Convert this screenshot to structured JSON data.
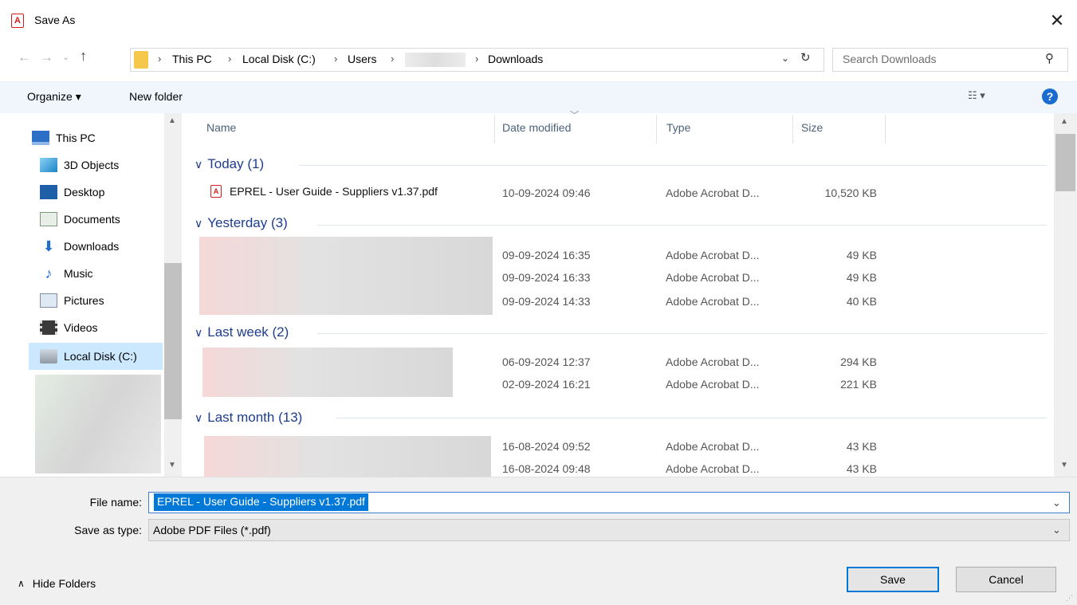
{
  "window": {
    "title": "Save As",
    "close_glyph": "✕",
    "accent_pdf": "#d21e1e"
  },
  "address": {
    "crumbs": [
      "This PC",
      "Local Disk (C:)",
      "Users",
      "Downloads"
    ],
    "separator": "›",
    "search_placeholder": "Search Downloads"
  },
  "toolbar": {
    "organize": "Organize ▾",
    "new_folder": "New folder",
    "view_icon": "view-options-icon",
    "help": "?"
  },
  "nav": {
    "items": [
      {
        "label": "This PC",
        "icon": "computer-icon"
      },
      {
        "label": "3D Objects",
        "icon": "cube-icon"
      },
      {
        "label": "Desktop",
        "icon": "desktop-icon"
      },
      {
        "label": "Documents",
        "icon": "documents-icon"
      },
      {
        "label": "Downloads",
        "icon": "download-arrow-icon"
      },
      {
        "label": "Music",
        "icon": "music-note-icon"
      },
      {
        "label": "Pictures",
        "icon": "pictures-icon"
      },
      {
        "label": "Videos",
        "icon": "film-icon"
      },
      {
        "label": "Local Disk (C:)",
        "icon": "drive-icon",
        "selected": true
      }
    ]
  },
  "columns": {
    "name": "Name",
    "date": "Date modified",
    "type": "Type",
    "size": "Size"
  },
  "groups": [
    {
      "label": "Today (1)",
      "rows": [
        {
          "name": "EPREL - User Guide - Suppliers v1.37.pdf",
          "date": "10-09-2024 09:46",
          "type": "Adobe Acrobat D...",
          "size": "10,520 KB"
        }
      ]
    },
    {
      "label": "Yesterday (3)",
      "rows": [
        {
          "name": "",
          "date": "09-09-2024 16:35",
          "type": "Adobe Acrobat D...",
          "size": "49 KB"
        },
        {
          "name": "",
          "date": "09-09-2024 16:33",
          "type": "Adobe Acrobat D...",
          "size": "49 KB"
        },
        {
          "name": "",
          "date": "09-09-2024 14:33",
          "type": "Adobe Acrobat D...",
          "size": "40 KB"
        }
      ]
    },
    {
      "label": "Last week (2)",
      "rows": [
        {
          "name": "",
          "date": "06-09-2024 12:37",
          "type": "Adobe Acrobat D...",
          "size": "294 KB"
        },
        {
          "name": "",
          "date": "02-09-2024 16:21",
          "type": "Adobe Acrobat D...",
          "size": "221 KB"
        }
      ]
    },
    {
      "label": "Last month (13)",
      "rows": [
        {
          "name": "",
          "date": "16-08-2024 09:52",
          "type": "Adobe Acrobat D...",
          "size": "43 KB"
        },
        {
          "name": "",
          "date": "16-08-2024 09:48",
          "type": "Adobe Acrobat D...",
          "size": "43 KB"
        }
      ]
    }
  ],
  "form": {
    "filename_label": "File name:",
    "filename_value": "EPREL - User Guide - Suppliers v1.37.pdf",
    "type_label": "Save as type:",
    "type_value": "Adobe PDF Files (*.pdf)",
    "hide_folders": "Hide Folders",
    "save": "Save",
    "cancel": "Cancel"
  }
}
